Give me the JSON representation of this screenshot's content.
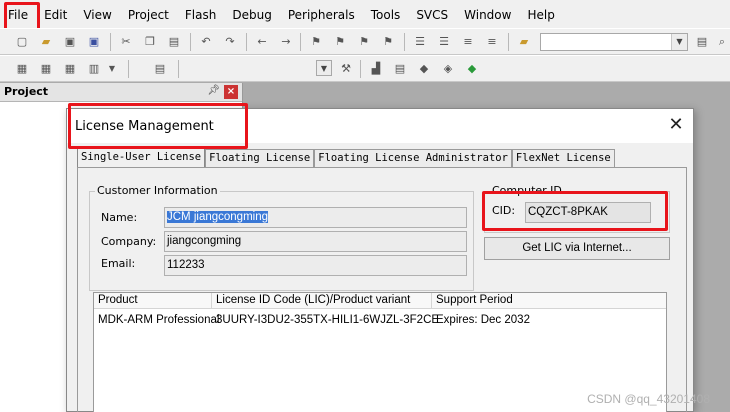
{
  "menubar": {
    "items": [
      "File",
      "Edit",
      "View",
      "Project",
      "Flash",
      "Debug",
      "Peripherals",
      "Tools",
      "SVCS",
      "Window",
      "Help"
    ]
  },
  "project_pane": {
    "title": "Project"
  },
  "dialog": {
    "title": "License Management",
    "close_glyph": "✕",
    "tabs": [
      "Single-User License",
      "Floating License",
      "Floating License Administrator",
      "FlexNet License"
    ],
    "customer_info": {
      "legend": "Customer Information",
      "name_label": "Name:",
      "name_value": "JCM jiangcongming",
      "company_label": "Company:",
      "company_value": "jiangcongming",
      "email_label": "Email:",
      "email_value": "112233"
    },
    "computer_id": {
      "legend": "Computer ID",
      "cid_label": "CID:",
      "cid_value": "CQZCT-8PKAK",
      "get_lic_button": "Get LIC via Internet..."
    },
    "license_table": {
      "columns": [
        "Product",
        "License ID Code (LIC)/Product variant",
        "Support Period"
      ],
      "rows": [
        [
          "MDK-ARM Professional",
          "3UURY-I3DU2-355TX-HILI1-6WJZL-3F2CE",
          "Expires: Dec 2032"
        ]
      ]
    }
  },
  "watermark": "CSDN @qq_43201408",
  "colors": {
    "highlight": "#e8141b",
    "selection": "#3a78d6"
  }
}
